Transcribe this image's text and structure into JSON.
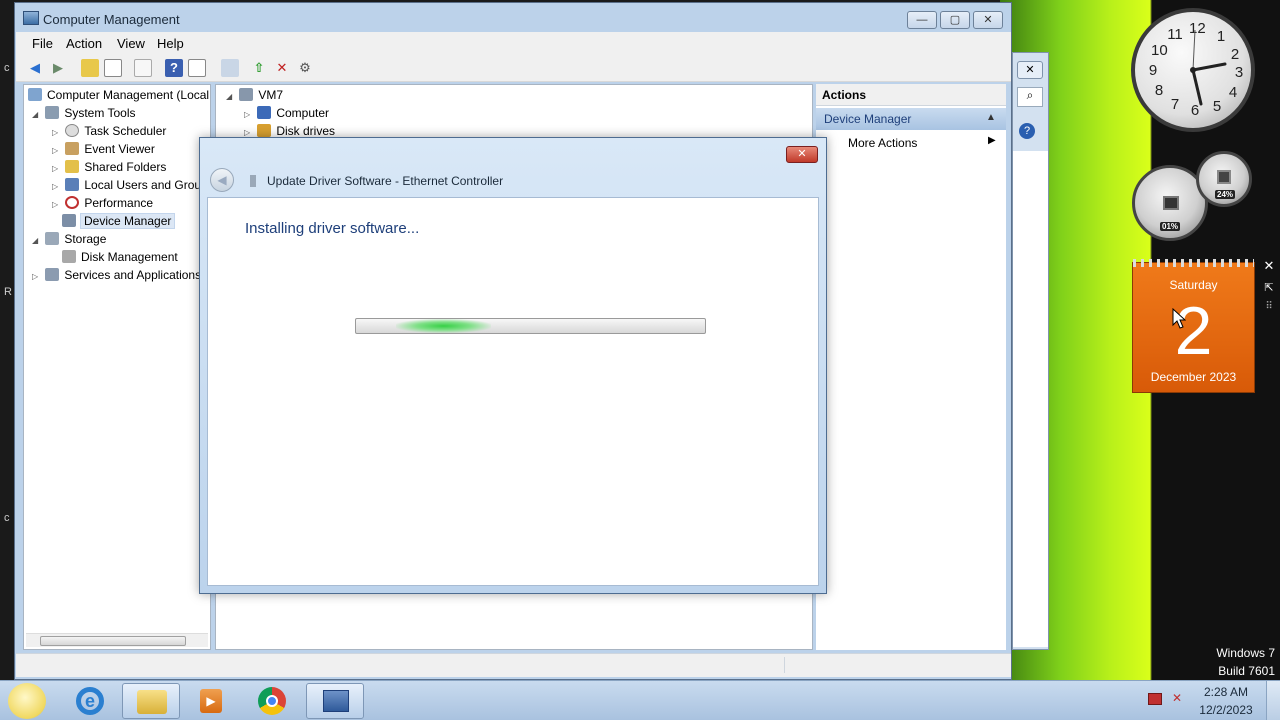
{
  "main_window": {
    "title": "Computer Management",
    "menu": [
      "File",
      "Action",
      "View",
      "Help"
    ]
  },
  "tree": {
    "root": "Computer Management (Local",
    "system_tools": "System Tools",
    "task_scheduler": "Task Scheduler",
    "event_viewer": "Event Viewer",
    "shared_folders": "Shared Folders",
    "local_users": "Local Users and Group",
    "performance": "Performance",
    "device_manager": "Device Manager",
    "storage": "Storage",
    "disk_management": "Disk Management",
    "services": "Services and Applications"
  },
  "device_tree": {
    "root": "VM7",
    "computer": "Computer",
    "disk_drives": "Disk drives"
  },
  "actions": {
    "header": "Actions",
    "section": "Device Manager",
    "more": "More Actions"
  },
  "dialog": {
    "title": "Update Driver Software - Ethernet Controller",
    "status": "Installing driver software..."
  },
  "gadgets": {
    "clock_numbers": [
      "12",
      "1",
      "2",
      "3",
      "4",
      "5",
      "6",
      "7",
      "8",
      "9",
      "10",
      "11"
    ],
    "cpu": "01%",
    "ram": "24%",
    "calendar_weekday": "Saturday",
    "calendar_day": "2",
    "calendar_month": "December 2023"
  },
  "watermark": {
    "line1": "Windows 7",
    "line2": "Build 7601"
  },
  "tray": {
    "time": "2:28 AM",
    "date": "12/2/2023"
  },
  "colors": {
    "accent": "#1e3f7a",
    "selection": "#dce7f5",
    "calendar": "#e8650f",
    "progress": "#36d046"
  }
}
